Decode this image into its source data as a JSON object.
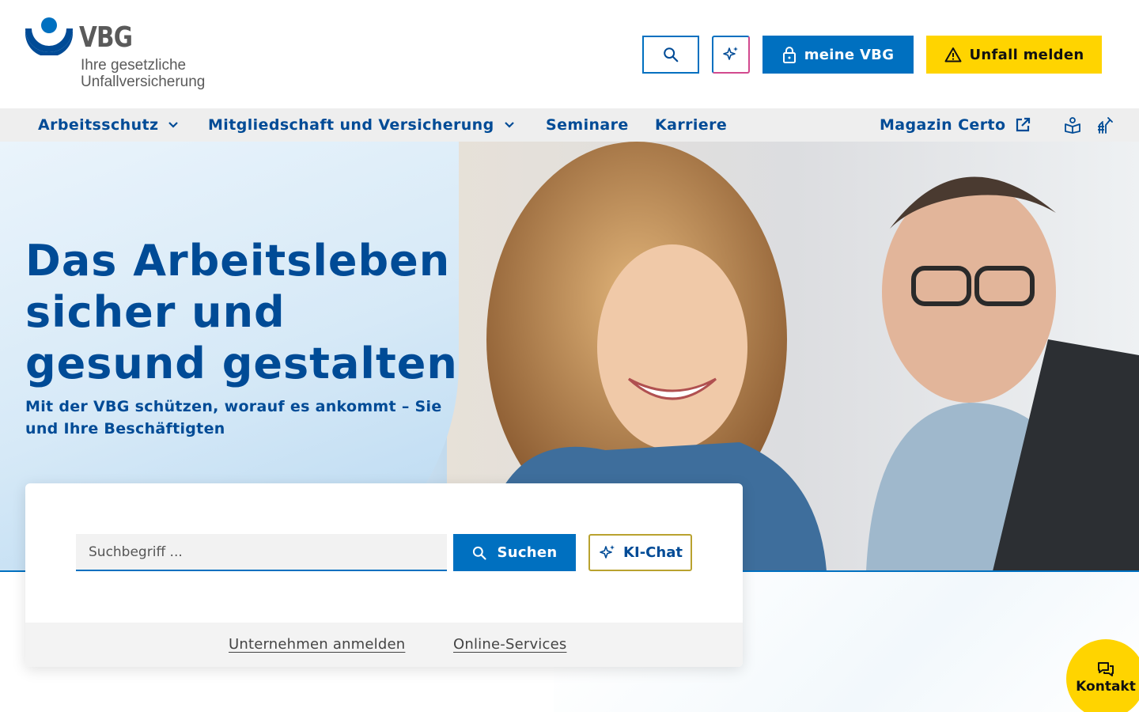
{
  "header": {
    "logo": {
      "brand": "VBG",
      "tagline_line1": "Ihre gesetzliche",
      "tagline_line2": "Unfallversicherung"
    },
    "search_button_icon": "search-icon",
    "ai_button_icon": "sparkle-icon",
    "meine_vbg_label": "meine VBG",
    "unfall_melden_label": "Unfall melden"
  },
  "nav": {
    "items": [
      {
        "label": "Arbeitsschutz",
        "has_dropdown": true
      },
      {
        "label": "Mitgliedschaft und Versicherung",
        "has_dropdown": true
      },
      {
        "label": "Seminare",
        "has_dropdown": false
      },
      {
        "label": "Karriere",
        "has_dropdown": false
      }
    ],
    "magazin_label": "Magazin Certo",
    "icons": [
      "easy-language-icon",
      "sign-language-icon"
    ]
  },
  "hero": {
    "title_line1": "Das Arbeitsleben",
    "title_line2": "sicher und",
    "title_line3": "gesund gestalten",
    "subtitle_line1": "Mit der VBG schützen, worauf es ankommt – Sie",
    "subtitle_line2": "und Ihre Beschäftigten"
  },
  "search": {
    "placeholder": "Suchbegriff ...",
    "value": "",
    "submit_label": "Suchen",
    "kichat_label": "KI-Chat",
    "footer_links": [
      "Unternehmen anmelden",
      "Online-Services"
    ]
  },
  "kontakt": {
    "label": "Kontakt"
  },
  "colors": {
    "primary_blue": "#0070c0",
    "dark_blue": "#004b96",
    "accent_yellow": "#ffd400",
    "nav_bg": "#eeeeee"
  }
}
